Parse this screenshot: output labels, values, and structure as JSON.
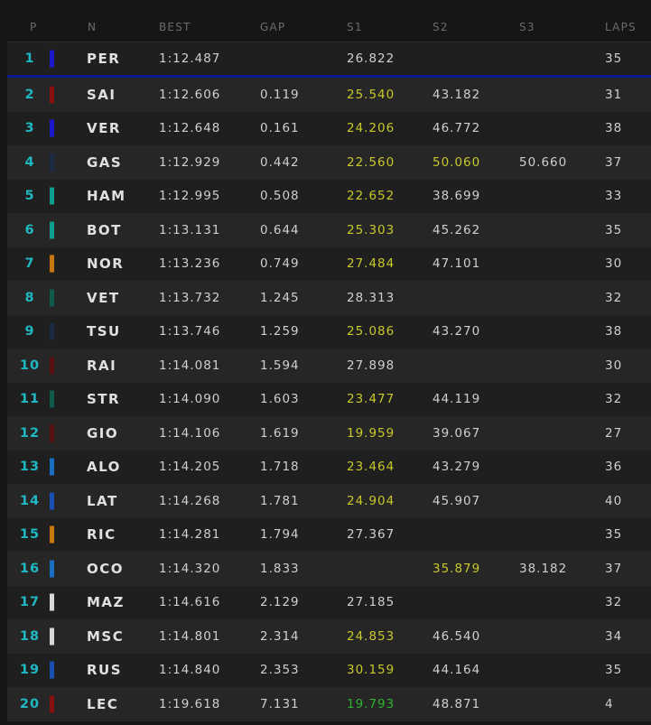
{
  "headers": {
    "pos": "P",
    "name": "N",
    "best": "BEST",
    "gap": "GAP",
    "s1": "S1",
    "s2": "S2",
    "s3": "S3",
    "laps": "LAPS"
  },
  "colors": {
    "position": "#1fb8c2",
    "personal_best": "#c8c82a",
    "overall_best": "#2fb32f",
    "leader_separator": "#0b1a8f"
  },
  "rows": [
    {
      "pos": "1",
      "driver": "PER",
      "team_color": "#1a1acc",
      "best": "1:12.487",
      "gap": "",
      "s1": "26.822",
      "s1_state": "normal",
      "s2": "",
      "s2_state": "normal",
      "s3": "",
      "laps": "35"
    },
    {
      "pos": "2",
      "driver": "SAI",
      "team_color": "#8a1010",
      "best": "1:12.606",
      "gap": "0.119",
      "s1": "25.540",
      "s1_state": "yellow",
      "s2": "43.182",
      "s2_state": "normal",
      "s3": "",
      "laps": "31"
    },
    {
      "pos": "3",
      "driver": "VER",
      "team_color": "#1a1acc",
      "best": "1:12.648",
      "gap": "0.161",
      "s1": "24.206",
      "s1_state": "yellow",
      "s2": "46.772",
      "s2_state": "normal",
      "s3": "",
      "laps": "38"
    },
    {
      "pos": "4",
      "driver": "GAS",
      "team_color": "#1c2b45",
      "best": "1:12.929",
      "gap": "0.442",
      "s1": "22.560",
      "s1_state": "yellow",
      "s2": "50.060",
      "s2_state": "yellow",
      "s3": "50.660",
      "laps": "37"
    },
    {
      "pos": "5",
      "driver": "HAM",
      "team_color": "#0f9e92",
      "best": "1:12.995",
      "gap": "0.508",
      "s1": "22.652",
      "s1_state": "yellow",
      "s2": "38.699",
      "s2_state": "normal",
      "s3": "",
      "laps": "33"
    },
    {
      "pos": "6",
      "driver": "BOT",
      "team_color": "#0f9e92",
      "best": "1:13.131",
      "gap": "0.644",
      "s1": "25.303",
      "s1_state": "yellow",
      "s2": "45.262",
      "s2_state": "normal",
      "s3": "",
      "laps": "35"
    },
    {
      "pos": "7",
      "driver": "NOR",
      "team_color": "#c7780f",
      "best": "1:13.236",
      "gap": "0.749",
      "s1": "27.484",
      "s1_state": "yellow",
      "s2": "47.101",
      "s2_state": "normal",
      "s3": "",
      "laps": "30"
    },
    {
      "pos": "8",
      "driver": "VET",
      "team_color": "#0e5a4c",
      "best": "1:13.732",
      "gap": "1.245",
      "s1": "28.313",
      "s1_state": "normal",
      "s2": "",
      "s2_state": "normal",
      "s3": "",
      "laps": "32"
    },
    {
      "pos": "9",
      "driver": "TSU",
      "team_color": "#1c2b45",
      "best": "1:13.746",
      "gap": "1.259",
      "s1": "25.086",
      "s1_state": "yellow",
      "s2": "43.270",
      "s2_state": "normal",
      "s3": "",
      "laps": "38"
    },
    {
      "pos": "10",
      "driver": "RAI",
      "team_color": "#5a1010",
      "best": "1:14.081",
      "gap": "1.594",
      "s1": "27.898",
      "s1_state": "normal",
      "s2": "",
      "s2_state": "normal",
      "s3": "",
      "laps": "30"
    },
    {
      "pos": "11",
      "driver": "STR",
      "team_color": "#0e5a4c",
      "best": "1:14.090",
      "gap": "1.603",
      "s1": "23.477",
      "s1_state": "yellow",
      "s2": "44.119",
      "s2_state": "normal",
      "s3": "",
      "laps": "32"
    },
    {
      "pos": "12",
      "driver": "GIO",
      "team_color": "#5a1010",
      "best": "1:14.106",
      "gap": "1.619",
      "s1": "19.959",
      "s1_state": "yellow",
      "s2": "39.067",
      "s2_state": "normal",
      "s3": "",
      "laps": "27"
    },
    {
      "pos": "13",
      "driver": "ALO",
      "team_color": "#1a6fc4",
      "best": "1:14.205",
      "gap": "1.718",
      "s1": "23.464",
      "s1_state": "yellow",
      "s2": "43.279",
      "s2_state": "normal",
      "s3": "",
      "laps": "36"
    },
    {
      "pos": "14",
      "driver": "LAT",
      "team_color": "#1a4fb4",
      "best": "1:14.268",
      "gap": "1.781",
      "s1": "24.904",
      "s1_state": "yellow",
      "s2": "45.907",
      "s2_state": "normal",
      "s3": "",
      "laps": "40"
    },
    {
      "pos": "15",
      "driver": "RIC",
      "team_color": "#c7780f",
      "best": "1:14.281",
      "gap": "1.794",
      "s1": "27.367",
      "s1_state": "normal",
      "s2": "",
      "s2_state": "normal",
      "s3": "",
      "laps": "35"
    },
    {
      "pos": "16",
      "driver": "OCO",
      "team_color": "#1a6fc4",
      "best": "1:14.320",
      "gap": "1.833",
      "s1": "",
      "s1_state": "normal",
      "s2": "35.879",
      "s2_state": "yellow",
      "s3": "38.182",
      "laps": "37"
    },
    {
      "pos": "17",
      "driver": "MAZ",
      "team_color": "#d8d8d8",
      "best": "1:14.616",
      "gap": "2.129",
      "s1": "27.185",
      "s1_state": "normal",
      "s2": "",
      "s2_state": "normal",
      "s3": "",
      "laps": "32"
    },
    {
      "pos": "18",
      "driver": "MSC",
      "team_color": "#d8d8d8",
      "best": "1:14.801",
      "gap": "2.314",
      "s1": "24.853",
      "s1_state": "yellow",
      "s2": "46.540",
      "s2_state": "normal",
      "s3": "",
      "laps": "34"
    },
    {
      "pos": "19",
      "driver": "RUS",
      "team_color": "#1a4fb4",
      "best": "1:14.840",
      "gap": "2.353",
      "s1": "30.159",
      "s1_state": "yellow",
      "s2": "44.164",
      "s2_state": "normal",
      "s3": "",
      "laps": "35"
    },
    {
      "pos": "20",
      "driver": "LEC",
      "team_color": "#8a1010",
      "best": "1:19.618",
      "gap": "7.131",
      "s1": "19.793",
      "s1_state": "green",
      "s2": "48.871",
      "s2_state": "normal",
      "s3": "",
      "laps": "4"
    }
  ]
}
